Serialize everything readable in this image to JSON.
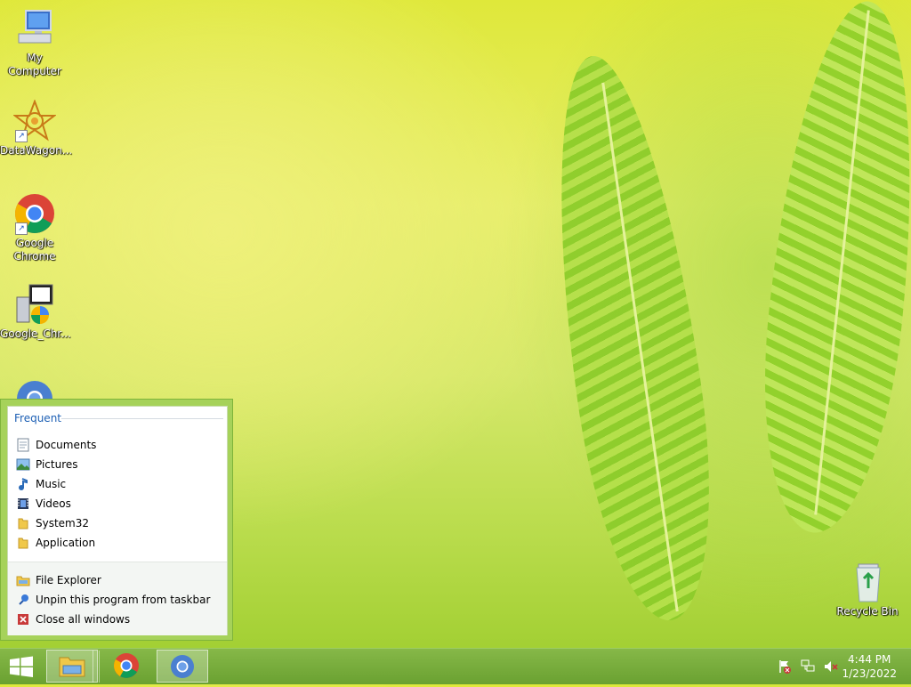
{
  "desktop_icons": [
    {
      "label": "My Computer"
    },
    {
      "label": "DataWagon..."
    },
    {
      "label": "Google Chrome"
    },
    {
      "label": "Google_Chr..."
    },
    {
      "label": "Recycle Bin"
    }
  ],
  "jumplist": {
    "section_title": "Frequent",
    "frequent": [
      {
        "label": "Documents",
        "icon": "document-icon"
      },
      {
        "label": "Pictures",
        "icon": "pictures-icon"
      },
      {
        "label": "Music",
        "icon": "music-icon"
      },
      {
        "label": "Videos",
        "icon": "videos-icon"
      },
      {
        "label": "System32",
        "icon": "folder-icon"
      },
      {
        "label": "Application",
        "icon": "folder-icon"
      }
    ],
    "tasks": [
      {
        "label": "File Explorer",
        "icon": "file-explorer-icon"
      },
      {
        "label": "Unpin this program from taskbar",
        "icon": "unpin-icon"
      },
      {
        "label": "Close all windows",
        "icon": "close-icon"
      }
    ]
  },
  "taskbar": {
    "pinned": [
      {
        "name": "File Explorer",
        "icon": "file-explorer-icon",
        "active": true
      },
      {
        "name": "Google Chrome",
        "icon": "chrome-icon",
        "active": false
      },
      {
        "name": "Chromium",
        "icon": "chromium-icon",
        "active": false
      }
    ],
    "tray_icons": [
      "action-center-flag-icon",
      "network-icon",
      "volume-muted-icon"
    ],
    "time": "4:44 PM",
    "date": "1/23/2022"
  },
  "colors": {
    "accent": "#6aa131",
    "jumplist_heading": "#1c5fb4"
  }
}
